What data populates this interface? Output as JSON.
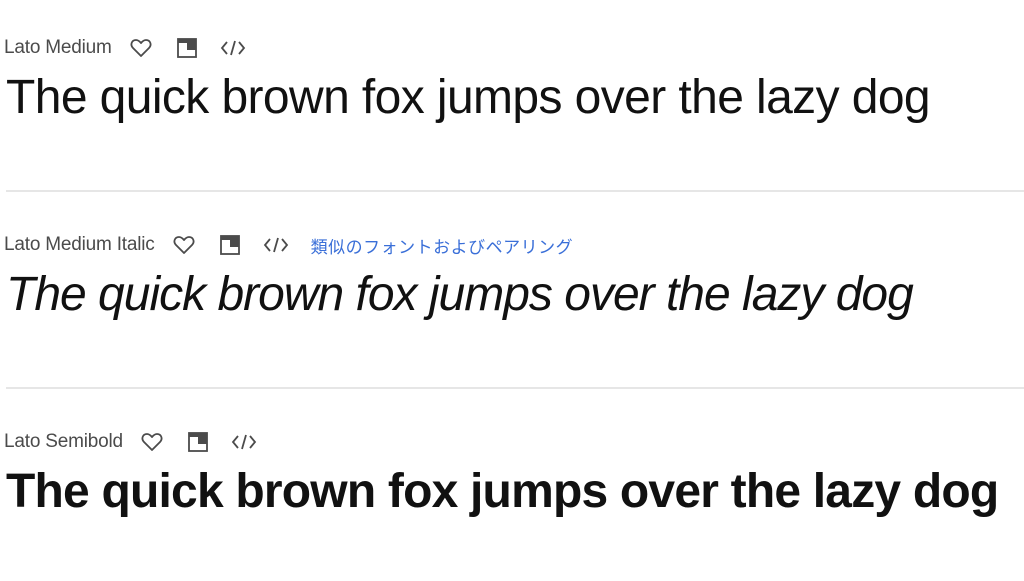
{
  "fonts": [
    {
      "name": "Lato Medium",
      "sample": "The quick brown fox jumps over the lazy dog",
      "icons": [
        "heart-icon",
        "add-to-collection-icon",
        "embed-code-icon"
      ]
    },
    {
      "name": "Lato Medium Italic",
      "sample": "The quick brown fox jumps over the lazy dog",
      "icons": [
        "heart-icon",
        "add-to-collection-icon",
        "embed-code-icon"
      ],
      "similar_link": "類似のフォントおよびペアリング"
    },
    {
      "name": "Lato Semibold",
      "sample": "The quick brown fox jumps over the lazy dog",
      "icons": [
        "heart-icon",
        "add-to-collection-icon",
        "embed-code-icon"
      ]
    }
  ],
  "colors": {
    "text": "#111111",
    "meta_text": "#4b4b4b",
    "link": "#3a6fd8",
    "divider": "#e6e6e6"
  }
}
